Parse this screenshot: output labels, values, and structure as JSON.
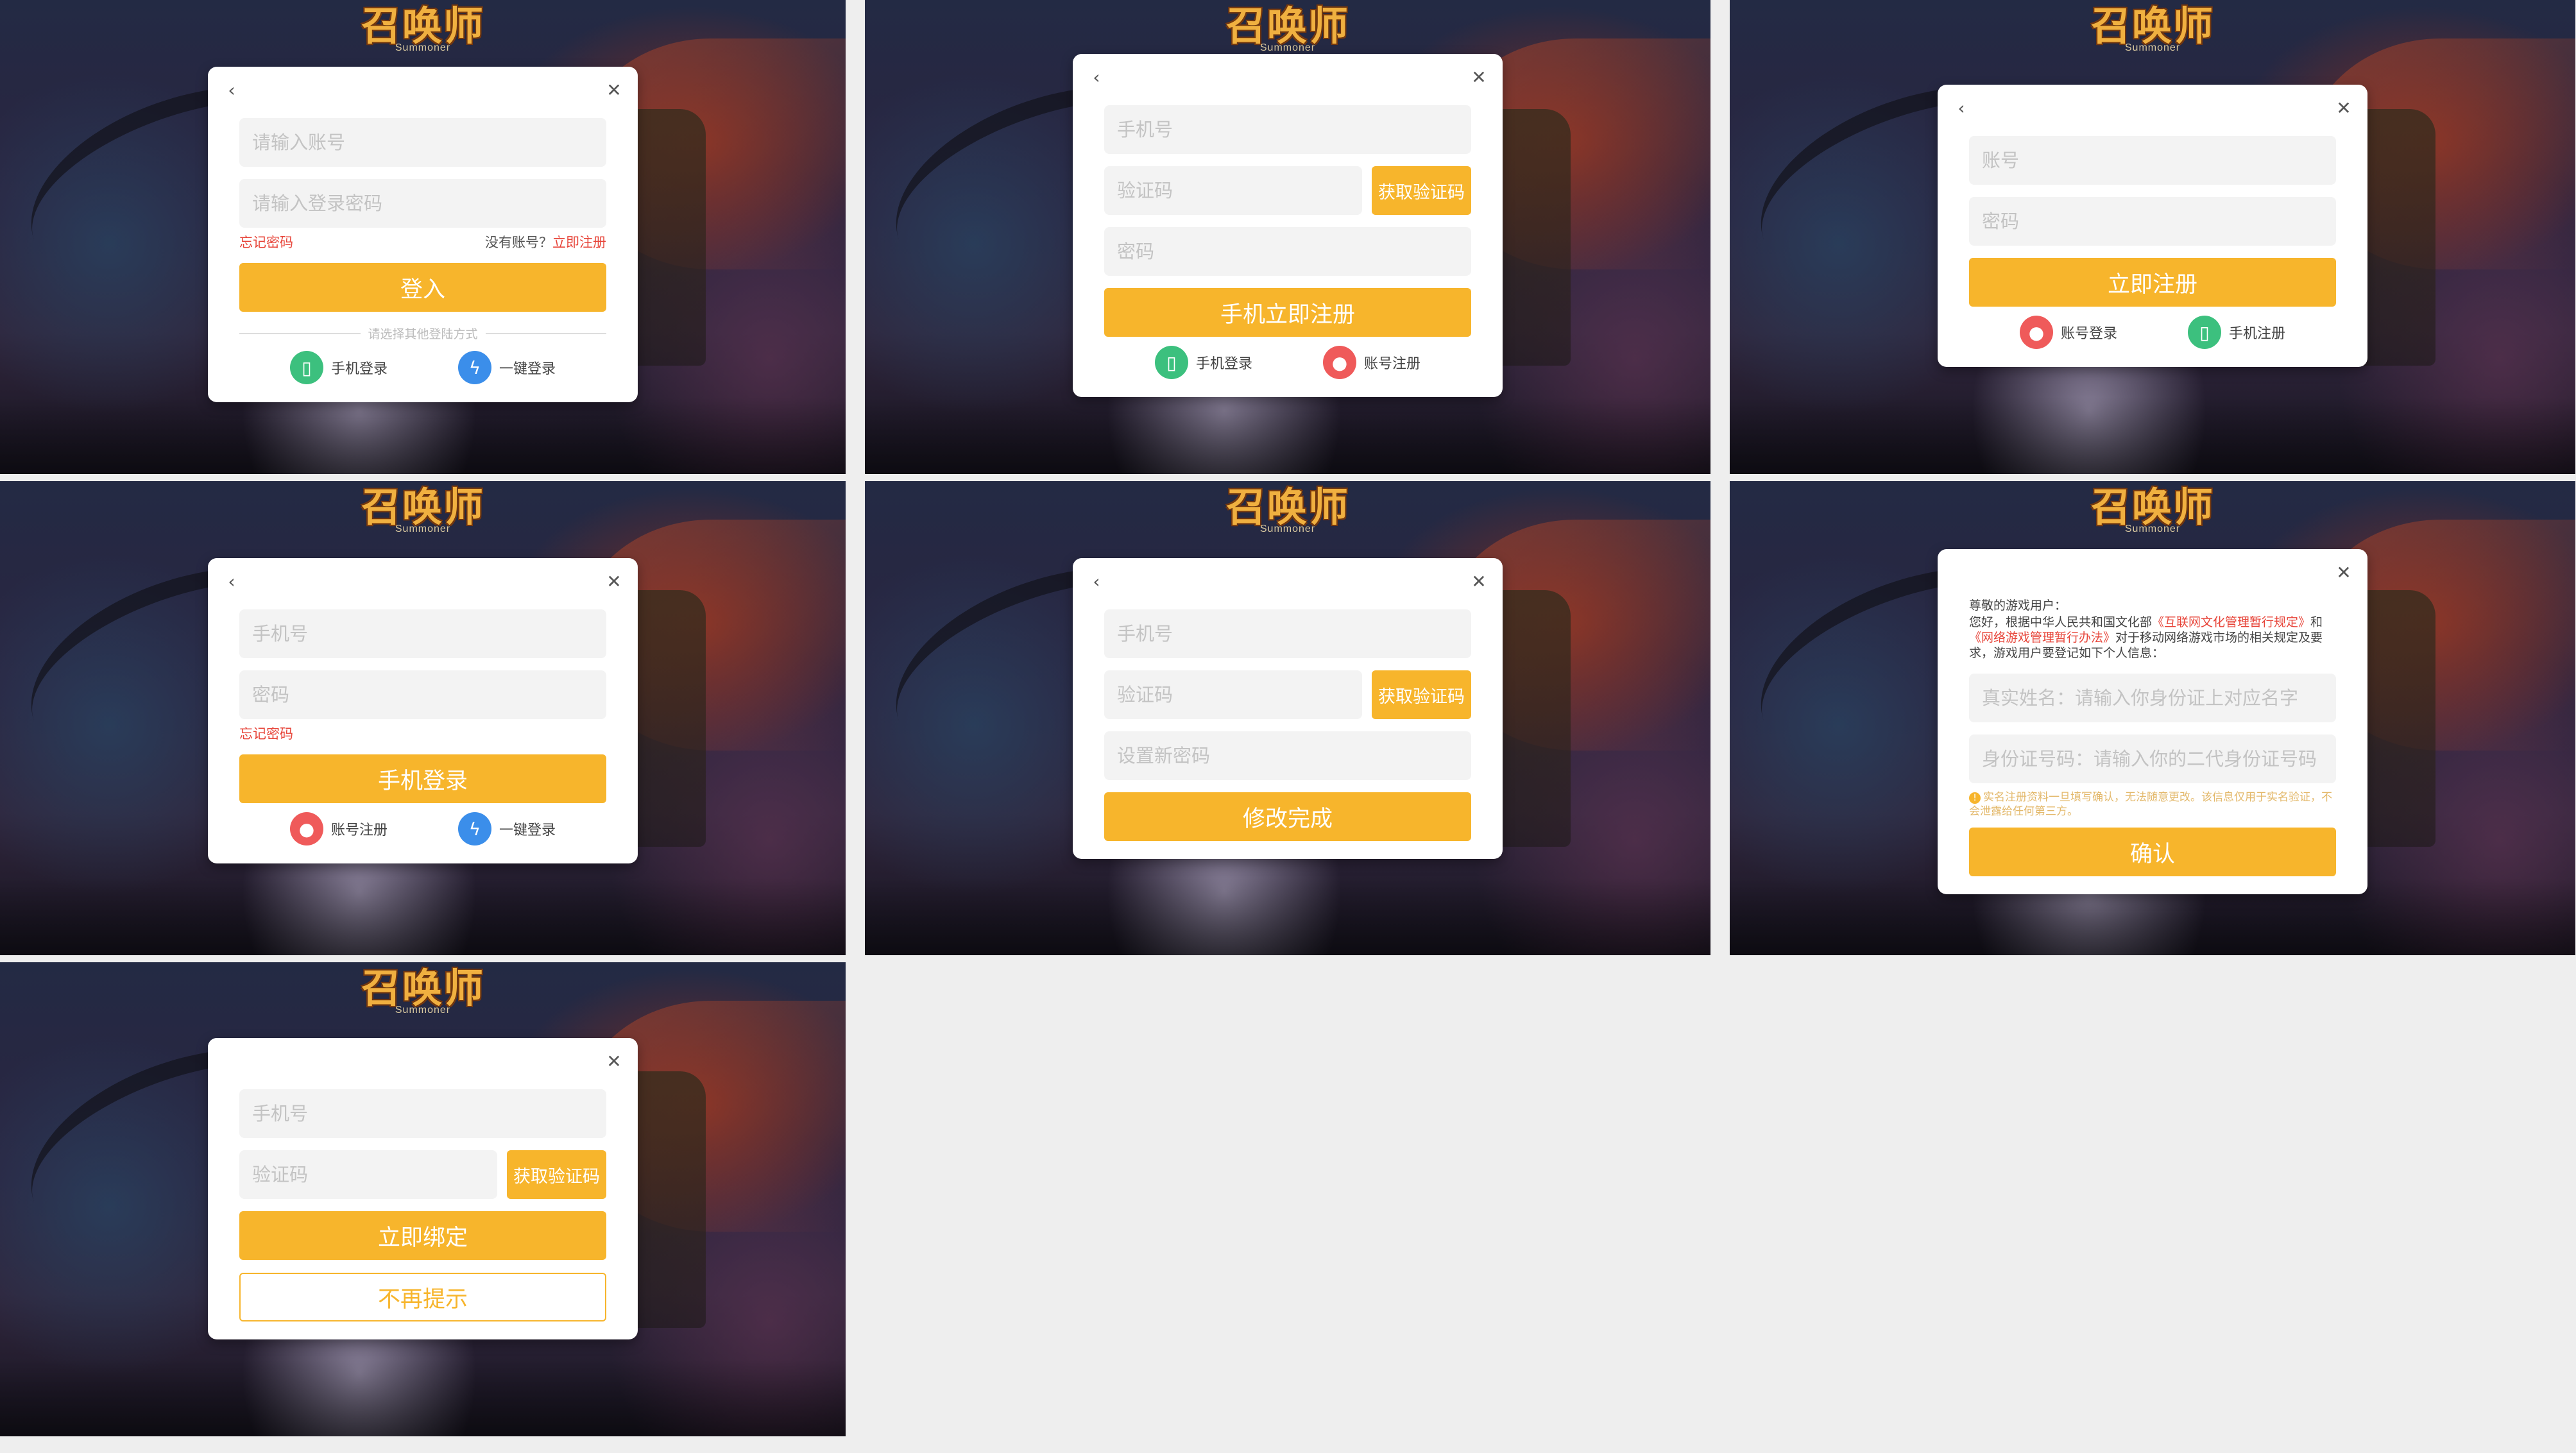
{
  "logo": {
    "title": "召唤师",
    "subtitle": "Summoner"
  },
  "icons": {
    "back": "chevron-left-icon",
    "close": "close-icon",
    "phone": "phone-icon",
    "user": "user-icon",
    "bolt": "bolt-icon",
    "info": "info-icon"
  },
  "colors": {
    "accent": "#f7b52c",
    "link_red": "#e7453a",
    "phone_icon": "#3cc07e",
    "user_icon": "#ef5a5a",
    "bolt_icon": "#3b8eea"
  },
  "screens": {
    "login": {
      "account_placeholder": "请输入账号",
      "password_placeholder": "请输入登录密码",
      "forgot": "忘记密码",
      "no_account": "没有账号？",
      "register_now": "立即注册",
      "submit": "登入",
      "other_methods": "请选择其他登陆方式",
      "alt1": "手机登录",
      "alt2": "一键登录"
    },
    "phone_register": {
      "phone_placeholder": "手机号",
      "code_placeholder": "验证码",
      "get_code": "获取验证码",
      "password_placeholder": "密码",
      "submit": "手机立即注册",
      "alt1": "手机登录",
      "alt2": "账号注册"
    },
    "account_register": {
      "account_placeholder": "账号",
      "password_placeholder": "密码",
      "submit": "立即注册",
      "alt1": "账号登录",
      "alt2": "手机注册"
    },
    "phone_login": {
      "phone_placeholder": "手机号",
      "password_placeholder": "密码",
      "forgot": "忘记密码",
      "submit": "手机登录",
      "alt1": "账号注册",
      "alt2": "一键登录"
    },
    "reset_password": {
      "phone_placeholder": "手机号",
      "code_placeholder": "验证码",
      "get_code": "获取验证码",
      "new_password_placeholder": "设置新密码",
      "submit": "修改完成"
    },
    "real_name": {
      "greeting": "尊敬的游戏用户：",
      "text_a": "您好，根据中华人民共和国文化部",
      "law1": "《互联网文化管理暂行规定》",
      "text_b": "和",
      "law2": "《网络游戏管理暂行办法》",
      "text_c": "对于移动网络游戏市场的相关规定及要求，游戏用户要登记如下个人信息：",
      "name_placeholder": "真实姓名：请输入你身份证上对应名字",
      "id_placeholder": "身份证号码：请输入你的二代身份证号码",
      "hint": "实名注册资料一旦填写确认，无法随意更改。该信息仅用于实名验证，不会泄露给任何第三方。",
      "submit": "确认"
    },
    "bind_phone": {
      "phone_placeholder": "手机号",
      "code_placeholder": "验证码",
      "get_code": "获取验证码",
      "submit": "立即绑定",
      "skip": "不再提示"
    }
  }
}
